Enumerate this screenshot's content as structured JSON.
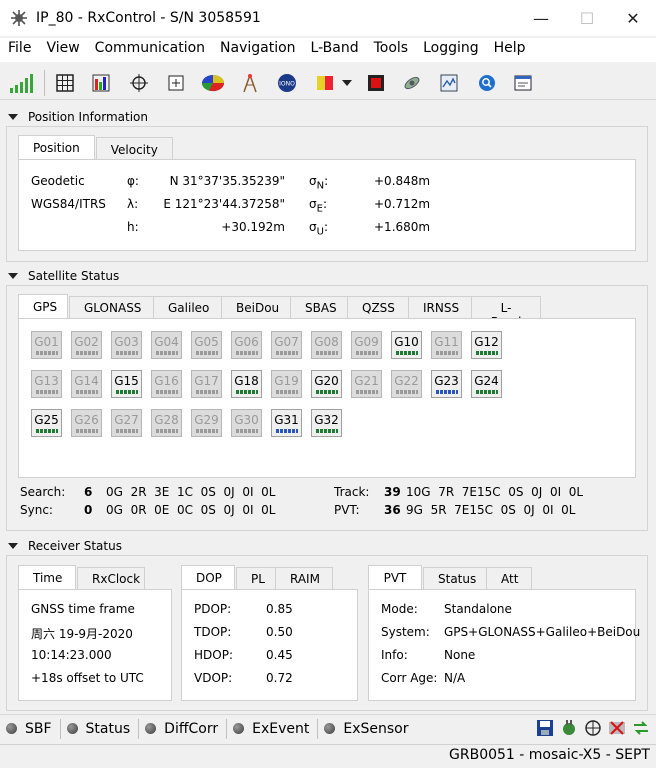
{
  "window": {
    "title": "IP_80 - RxControl - S/N 3058591",
    "minimize": "—",
    "maximize": "☐",
    "close": "✕"
  },
  "menu": [
    "File",
    "View",
    "Communication",
    "Navigation",
    "L-Band",
    "Tools",
    "Logging",
    "Help"
  ],
  "toolbar": {
    "icons": [
      "signal-strength-icon",
      "grid-icon",
      "color-bars-icon",
      "crosshair-icon",
      "add-point-icon",
      "pie-chart-icon",
      "tower-icon",
      "iono-icon",
      "flag-icon",
      "dropdown-icon",
      "red-square-icon",
      "satellite-icon",
      "map-icon",
      "search-icon",
      "window-icon"
    ]
  },
  "position_section": {
    "title": "Position Information",
    "tabs": [
      "Position",
      "Velocity"
    ],
    "rows": [
      {
        "label": "Geodetic",
        "sym": "φ:",
        "value": "N 31°37'35.35239\"",
        "sigma_sym": "σN:",
        "sigma": "+0.848m"
      },
      {
        "label": "WGS84/ITRS",
        "sym": "λ:",
        "value": "E 121°23'44.37258\"",
        "sigma_sym": "σE:",
        "sigma": "+0.712m"
      },
      {
        "label": "",
        "sym": "h:",
        "value": "+30.192m",
        "sigma_sym": "σU:",
        "sigma": "+1.680m"
      }
    ]
  },
  "satellite_section": {
    "title": "Satellite Status",
    "tabs": [
      "GPS",
      "GLONASS",
      "Galileo",
      "BeiDou",
      "SBAS",
      "QZSS",
      "IRNSS",
      "L-Band"
    ],
    "sats": [
      {
        "id": "G01",
        "on": false
      },
      {
        "id": "G02",
        "on": false
      },
      {
        "id": "G03",
        "on": false
      },
      {
        "id": "G04",
        "on": false
      },
      {
        "id": "G05",
        "on": false
      },
      {
        "id": "G06",
        "on": false
      },
      {
        "id": "G07",
        "on": false
      },
      {
        "id": "G08",
        "on": false
      },
      {
        "id": "G09",
        "on": false
      },
      {
        "id": "G10",
        "on": true
      },
      {
        "id": "G11",
        "on": false
      },
      {
        "id": "G12",
        "on": true
      },
      {
        "id": "G13",
        "on": false
      },
      {
        "id": "G14",
        "on": false
      },
      {
        "id": "G15",
        "on": true
      },
      {
        "id": "G16",
        "on": false
      },
      {
        "id": "G17",
        "on": false
      },
      {
        "id": "G18",
        "on": true
      },
      {
        "id": "G19",
        "on": false
      },
      {
        "id": "G20",
        "on": true
      },
      {
        "id": "G21",
        "on": false
      },
      {
        "id": "G22",
        "on": false
      },
      {
        "id": "G23",
        "on": true,
        "blue": true
      },
      {
        "id": "G24",
        "on": true
      },
      {
        "id": "G25",
        "on": true
      },
      {
        "id": "G26",
        "on": false
      },
      {
        "id": "G27",
        "on": false
      },
      {
        "id": "G28",
        "on": false
      },
      {
        "id": "G29",
        "on": false
      },
      {
        "id": "G30",
        "on": false
      },
      {
        "id": "G31",
        "on": true,
        "blue": true
      },
      {
        "id": "G32",
        "on": true
      }
    ],
    "search": {
      "label": "Search:",
      "count": "6",
      "detail": "0G  2R  3E  1C  0S  0J  0I  0L"
    },
    "sync": {
      "label": "Sync:",
      "count": "0",
      "detail": "0G  0R  0E  0C  0S  0J  0I  0L"
    },
    "track": {
      "label": "Track:",
      "count": "39",
      "detail": "10G  7R  7E15C  0S  0J  0I  0L"
    },
    "pvt": {
      "label": "PVT:",
      "count": "36",
      "detail": "9G  5R  7E15C  0S  0J  0I  0L"
    }
  },
  "receiver_section": {
    "title": "Receiver Status",
    "time_tabs": [
      "Time",
      "RxClock"
    ],
    "time_lines": [
      "GNSS time frame",
      "周六 19-9月-2020",
      "10:14:23.000",
      "+18s offset to UTC"
    ],
    "dop_tabs": [
      "DOP",
      "PL",
      "RAIM"
    ],
    "dop": [
      {
        "k": "PDOP:",
        "v": "0.85"
      },
      {
        "k": "TDOP:",
        "v": "0.50"
      },
      {
        "k": "HDOP:",
        "v": "0.45"
      },
      {
        "k": "VDOP:",
        "v": "0.72"
      }
    ],
    "pvt_tabs": [
      "PVT",
      "Status",
      "Att"
    ],
    "pvt": [
      {
        "k": "Mode:",
        "v": "Standalone"
      },
      {
        "k": "System:",
        "v": "GPS+GLONASS+Galileo+BeiDou"
      },
      {
        "k": "Info:",
        "v": "None"
      },
      {
        "k": "Corr Age:",
        "v": "N/A"
      }
    ]
  },
  "statusbar": {
    "items": [
      "SBF",
      "Status",
      "DiffCorr",
      "ExEvent",
      "ExSensor"
    ]
  },
  "footer": {
    "text": "GRB0051 - mosaic-X5 - SEPT"
  }
}
